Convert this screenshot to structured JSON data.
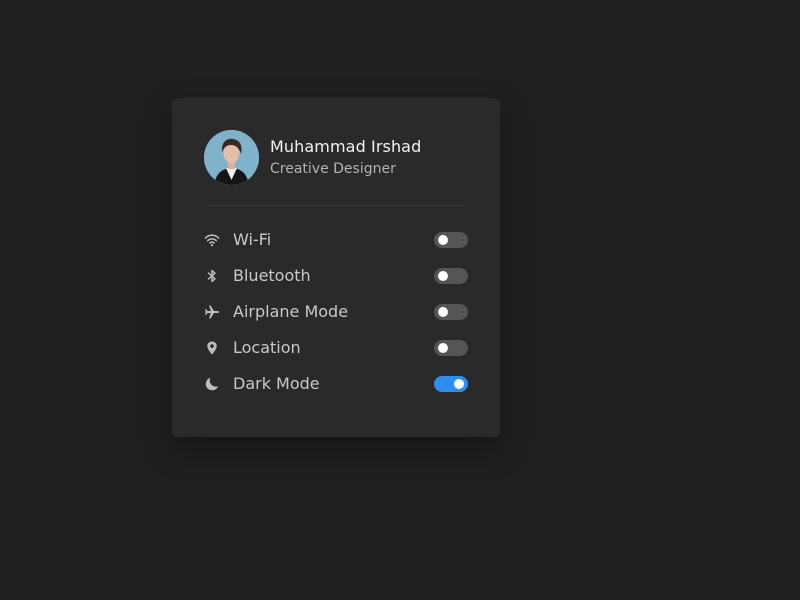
{
  "profile": {
    "name": "Muhammad Irshad",
    "role": "Creative Designer"
  },
  "settings": [
    {
      "label": "Wi-Fi",
      "icon": "wifi-icon",
      "enabled": false
    },
    {
      "label": "Bluetooth",
      "icon": "bluetooth-icon",
      "enabled": false
    },
    {
      "label": "Airplane Mode",
      "icon": "airplane-icon",
      "enabled": false
    },
    {
      "label": "Location",
      "icon": "location-pin-icon",
      "enabled": false
    },
    {
      "label": "Dark Mode",
      "icon": "moon-icon",
      "enabled": true
    }
  ],
  "colors": {
    "background": "#202020",
    "card": "#2a2a2a",
    "toggle_off": "#555555",
    "toggle_on": "#2d8ef0"
  }
}
